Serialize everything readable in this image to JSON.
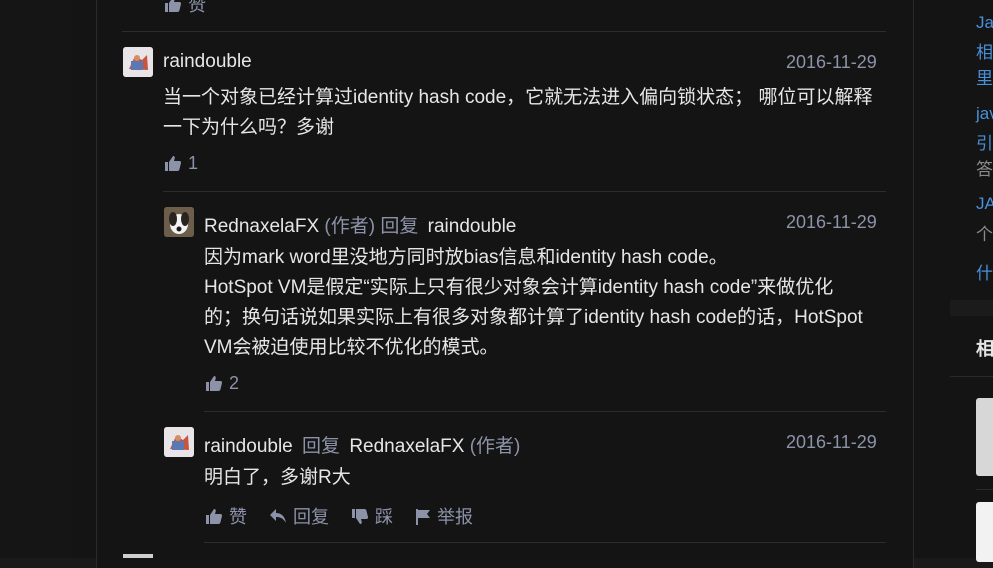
{
  "top_partial": {
    "like_label": "赞"
  },
  "comments": [
    {
      "author": "raindouble",
      "date": "2016-11-29",
      "lines": [
        "当一个对象已经计算过identity hash code，它就无法进入偏向锁状态； 哪位可以解释",
        "一下为什么吗？多谢"
      ],
      "likes": "1"
    },
    {
      "author": "RednaxelaFX",
      "author_tag": "(作者)",
      "reply_word": "回复",
      "reply_to": "raindouble",
      "date": "2016-11-29",
      "lines": [
        "因为mark word里没地方同时放bias信息和identity hash code。",
        "HotSpot VM是假定“实际上只有很少对象会计算identity hash code”来做优化",
        "的；换句话说如果实际上有很多对象都计算了identity hash code的话，HotSpot",
        "VM会被迫使用比较不优化的模式。"
      ],
      "likes": "2"
    },
    {
      "author": "raindouble",
      "reply_word": "回复",
      "reply_to": "RednaxelaFX",
      "reply_to_tag": "(作者)",
      "date": "2016-11-29",
      "lines": [
        "明白了，多谢R大"
      ],
      "actions": {
        "like": "赞",
        "reply": "回复",
        "dislike": "踩",
        "report": "举报"
      }
    }
  ],
  "right_panel": {
    "related_list": [
      {
        "l1": "Ja",
        "l2": "相",
        "l3": "里"
      },
      {
        "l1": "jav",
        "l2": "引",
        "l3": "答"
      },
      {
        "l1": "JA",
        "l2": "个"
      },
      {
        "l1": "什"
      }
    ],
    "section_title": "相"
  },
  "colors": {
    "background": "#141414",
    "text": "#e6e6e6",
    "muted": "#8c93a8",
    "link": "#4a90d9"
  }
}
